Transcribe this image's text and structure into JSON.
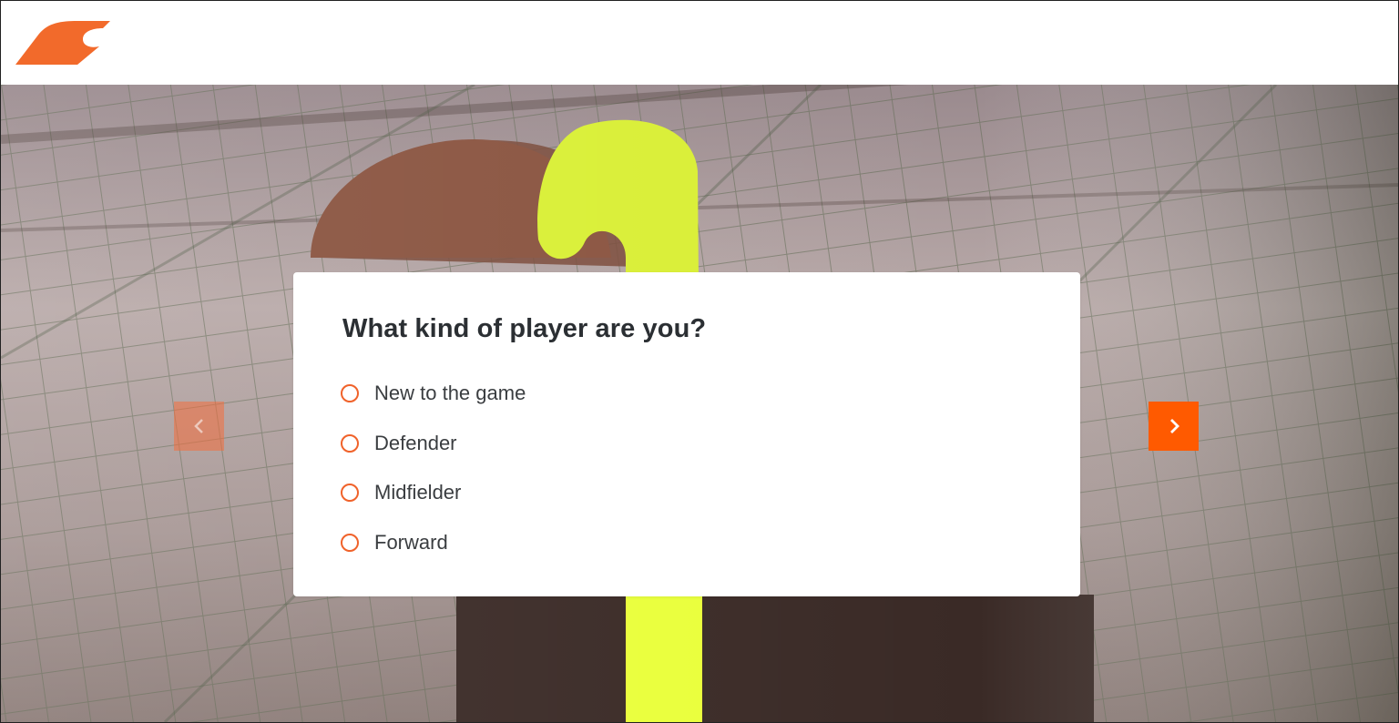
{
  "brand": {
    "logo_icon": "brand-swoosh-logo",
    "accent_color": "#ff5a00"
  },
  "quiz": {
    "question": "What kind of player are you?",
    "options": [
      {
        "label": "New to the game",
        "selected": false
      },
      {
        "label": "Defender",
        "selected": false
      },
      {
        "label": "Midfielder",
        "selected": false
      },
      {
        "label": "Forward",
        "selected": false
      }
    ]
  },
  "navigation": {
    "prev_icon": "chevron-left-icon",
    "next_icon": "chevron-right-icon",
    "prev_enabled": false,
    "next_enabled": true
  }
}
